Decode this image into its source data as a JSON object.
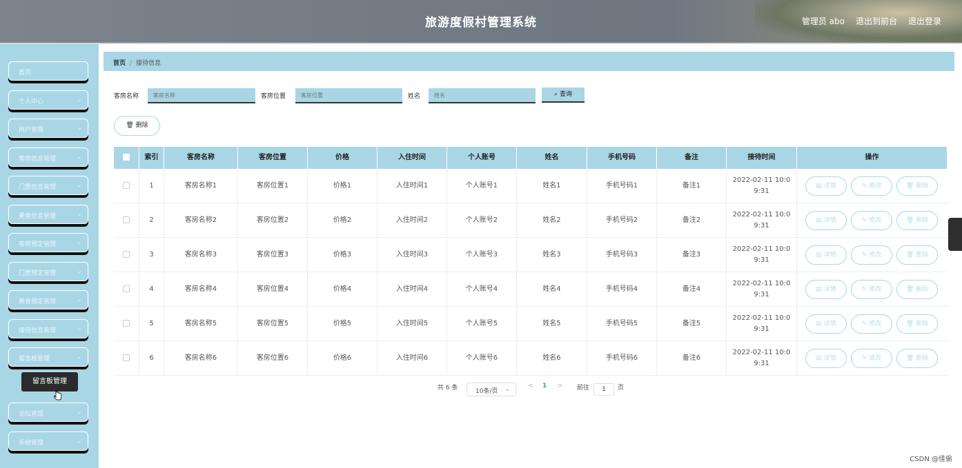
{
  "header": {
    "title": "旅游度假村管理系统",
    "user": "管理员 abo",
    "to_front": "退出到前台",
    "logout": "退出登录"
  },
  "sidebar": {
    "items": [
      {
        "label": "首页",
        "has_chevron": false
      },
      {
        "label": "个人中心",
        "has_chevron": true
      },
      {
        "label": "用户管理",
        "has_chevron": true
      },
      {
        "label": "客房信息管理",
        "has_chevron": true
      },
      {
        "label": "门票信息管理",
        "has_chevron": true
      },
      {
        "label": "美食信息管理",
        "has_chevron": true
      },
      {
        "label": "客房预定管理",
        "has_chevron": true
      },
      {
        "label": "门票预定管理",
        "has_chevron": true
      },
      {
        "label": "美食预定管理",
        "has_chevron": true
      },
      {
        "label": "接待信息管理",
        "has_chevron": true
      },
      {
        "label": "留言板管理",
        "has_chevron": true
      },
      {
        "label": "论坛管理",
        "has_chevron": true
      },
      {
        "label": "系统管理",
        "has_chevron": true
      }
    ],
    "tooltip": "留言板管理",
    "chevron": "⌄"
  },
  "breadcrumb": {
    "home": "首页",
    "separator": "/",
    "current": "接待信息"
  },
  "search": {
    "room_name_label": "客房名称",
    "room_name_placeholder": "客房名称",
    "room_location_label": "客房位置",
    "room_location_placeholder": "客房位置",
    "name_label": "姓名",
    "name_placeholder": "姓名",
    "query_button": "查询"
  },
  "actions": {
    "delete": "删除"
  },
  "table": {
    "columns": [
      "",
      "索引",
      "客房名称",
      "客房位置",
      "价格",
      "入住时间",
      "个人账号",
      "姓名",
      "手机号码",
      "备注",
      "接待时间",
      "操作"
    ],
    "rows": [
      [
        "1",
        "客房名称1",
        "客房位置1",
        "价格1",
        "入住时间1",
        "个人账号1",
        "姓名1",
        "手机号码1",
        "备注1",
        "2022-02-11 10:0",
        "9:31"
      ],
      [
        "2",
        "客房名称2",
        "客房位置2",
        "价格2",
        "入住时间2",
        "个人账号2",
        "姓名2",
        "手机号码2",
        "备注2",
        "2022-02-11 10:0",
        "9:31"
      ],
      [
        "3",
        "客房名称3",
        "客房位置3",
        "价格3",
        "入住时间3",
        "个人账号3",
        "姓名3",
        "手机号码3",
        "备注3",
        "2022-02-11 10:0",
        "9:31"
      ],
      [
        "4",
        "客房名称4",
        "客房位置4",
        "价格4",
        "入住时间4",
        "个人账号4",
        "姓名4",
        "手机号码4",
        "备注4",
        "2022-02-11 10:0",
        "9:31"
      ],
      [
        "5",
        "客房名称5",
        "客房位置5",
        "价格5",
        "入住时间5",
        "个人账号5",
        "姓名5",
        "手机号码5",
        "备注5",
        "2022-02-11 10:0",
        "9:31"
      ],
      [
        "6",
        "客房名称6",
        "客房位置6",
        "价格6",
        "入住时间6",
        "个人账号6",
        "姓名6",
        "手机号码6",
        "备注6",
        "2022-02-11 10:0",
        "9:31"
      ]
    ],
    "op_detail": "详情",
    "op_edit": "修改",
    "op_delete": "删除"
  },
  "pagination": {
    "total": "共 6 条",
    "page_size": "10条/页",
    "prev": "<",
    "current": "1",
    "next": ">",
    "goto": "前往",
    "goto_value": "1",
    "page_unit": "页"
  },
  "watermark": "CSDN @佳偷",
  "colors": {
    "accent": "#a9d6e5",
    "header": "#737b84",
    "active_page": "#2aa3c5"
  }
}
